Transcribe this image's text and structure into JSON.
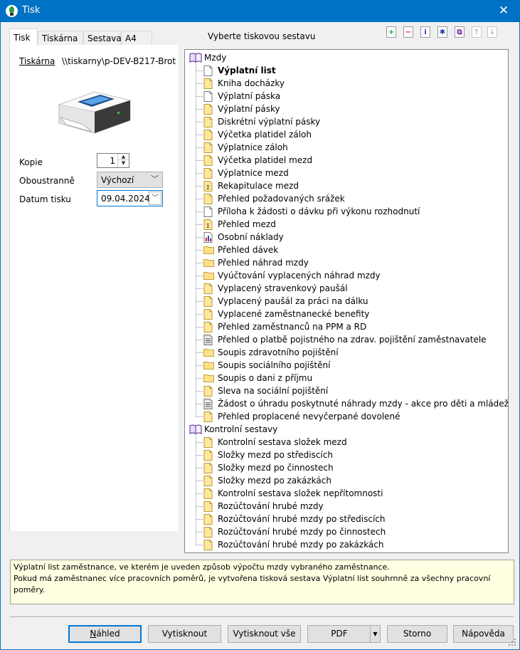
{
  "window": {
    "title": "Tisk"
  },
  "tabs": [
    "Tisk",
    "Tiskárna",
    "Sestava",
    "A4"
  ],
  "panel": {
    "printer_label": "Tiskárna",
    "printer_value": "\\\\tiskarny\\p-DEV-B217-Brot",
    "copies_label": "Kopie",
    "copies_value": "1",
    "duplex_label": "Oboustranně",
    "duplex_value": "Výchozí",
    "date_label": "Datum tisku",
    "date_value": "09.04.2024"
  },
  "heading": "Vyberte tiskovou sestavu",
  "toolbar_icons": [
    "add-icon",
    "remove-icon",
    "info-icon",
    "star-icon",
    "copy-icon",
    "move-up-icon",
    "move-down-icon"
  ],
  "tree": {
    "groups": [
      {
        "label": "Mzdy",
        "items": [
          {
            "label": "Výplatní list",
            "icon": "doc-white",
            "selected": true
          },
          {
            "label": "Kniha docházky",
            "icon": "doc-yellow"
          },
          {
            "label": "Výplatní páska",
            "icon": "doc-white"
          },
          {
            "label": "Výplatní pásky",
            "icon": "doc-yellow"
          },
          {
            "label": "Diskrétní výplatní pásky",
            "icon": "doc-yellow"
          },
          {
            "label": "Výčetka platidel záloh",
            "icon": "doc-yellow"
          },
          {
            "label": "Výplatnice záloh",
            "icon": "doc-yellow"
          },
          {
            "label": "Výčetka platidel mezd",
            "icon": "doc-yellow"
          },
          {
            "label": "Výplatnice mezd",
            "icon": "doc-yellow"
          },
          {
            "label": "Rekapitulace mezd",
            "icon": "doc-sum"
          },
          {
            "label": "Přehled požadovaných srážek",
            "icon": "doc-yellow"
          },
          {
            "label": "Příloha k žádosti o dávku při výkonu rozhodnutí",
            "icon": "doc-white"
          },
          {
            "label": "Přehled mezd",
            "icon": "doc-sum"
          },
          {
            "label": "Osobní náklady",
            "icon": "doc-chart"
          },
          {
            "label": "Přehled dávek",
            "icon": "folder"
          },
          {
            "label": "Přehled náhrad mzdy",
            "icon": "folder"
          },
          {
            "label": "Vyúčtování vyplacených náhrad mzdy",
            "icon": "folder"
          },
          {
            "label": "Vyplacený stravenkový paušál",
            "icon": "doc-yellow"
          },
          {
            "label": "Vyplacený paušál za práci na dálku",
            "icon": "doc-yellow"
          },
          {
            "label": "Vyplacené zaměstnanecké benefity",
            "icon": "doc-yellow"
          },
          {
            "label": "Přehled zaměstnanců na PPM a RD",
            "icon": "doc-yellow"
          },
          {
            "label": "Přehled o platbě pojistného na zdrav. pojištění zaměstnavatele",
            "icon": "doc-form"
          },
          {
            "label": "Soupis zdravotního pojištění",
            "icon": "folder"
          },
          {
            "label": "Soupis sociálního pojištění",
            "icon": "folder"
          },
          {
            "label": "Soupis o dani z příjmu",
            "icon": "folder"
          },
          {
            "label": "Sleva na sociální pojištění",
            "icon": "doc-yellow"
          },
          {
            "label": "Žádost o úhradu poskytnuté náhrady mzdy - akce pro děti a mládež",
            "icon": "doc-form"
          },
          {
            "label": "Přehled proplacené nevyčerpané dovolené",
            "icon": "doc-yellow"
          }
        ]
      },
      {
        "label": "Kontrolní sestavy",
        "items": [
          {
            "label": "Kontrolní sestava složek mezd",
            "icon": "doc-yellow"
          },
          {
            "label": "Složky mezd po střediscích",
            "icon": "doc-yellow"
          },
          {
            "label": "Složky mezd po činnostech",
            "icon": "doc-yellow"
          },
          {
            "label": "Složky mezd po zakázkách",
            "icon": "doc-yellow"
          },
          {
            "label": "Kontrolní sestava složek nepřítomnosti",
            "icon": "doc-yellow"
          },
          {
            "label": "Rozúčtování hrubé mzdy",
            "icon": "doc-yellow"
          },
          {
            "label": "Rozúčtování hrubé mzdy po střediscích",
            "icon": "doc-yellow"
          },
          {
            "label": "Rozúčtování hrubé mzdy po činnostech",
            "icon": "doc-yellow"
          },
          {
            "label": "Rozúčtování hrubé mzdy po zakázkách",
            "icon": "doc-yellow"
          }
        ]
      }
    ]
  },
  "description": {
    "line1": "Výplatní list zaměstnance, ve kterém je uveden způsob výpočtu mzdy vybraného zaměstnance.",
    "line2": "Pokud má zaměstnanec více pracovních poměrů, je vytvořena tisková sestava Výplatní list souhrnně za všechny pracovní poměry."
  },
  "buttons": {
    "preview": "Náhled",
    "print": "Vytisknout",
    "print_all": "Vytisknout vše",
    "pdf": "PDF",
    "cancel": "Storno",
    "help": "Nápověda"
  },
  "colors": {
    "titlebar": "#0072c6",
    "accent": "#0078d7",
    "description_bg": "#ffffe1"
  }
}
